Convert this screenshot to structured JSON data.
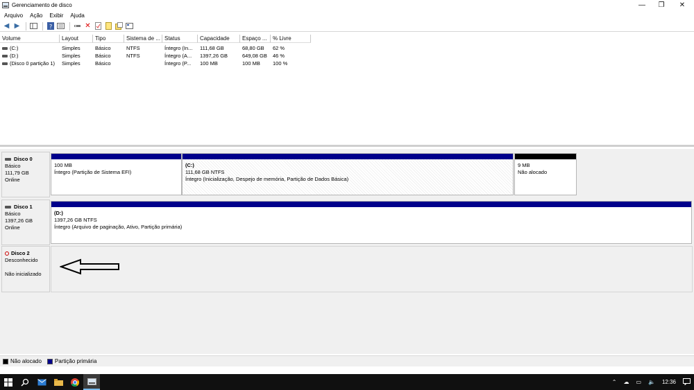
{
  "window": {
    "title": "Gerenciamento de disco",
    "controls": [
      "—",
      "❐",
      "✕"
    ]
  },
  "menu": [
    "Arquivo",
    "Ação",
    "Exibir",
    "Ajuda"
  ],
  "toolbar_icons": [
    "back-icon",
    "forward-icon",
    "console-tree-icon",
    "properties-icon",
    "help-icon",
    "list-view-icon",
    "connect-icon",
    "delete-icon",
    "check-icon",
    "new-volume-icon",
    "format-icon",
    "more-icon"
  ],
  "volume_list": {
    "columns": [
      "Volume",
      "Layout",
      "Tipo",
      "Sistema de ...",
      "Status",
      "Capacidade",
      "Espaço ...",
      "% Livre"
    ],
    "rows": [
      [
        "(C:)",
        "Simples",
        "Básico",
        "NTFS",
        "Íntegro (In...",
        "111,68 GB",
        "68,80 GB",
        "62 %"
      ],
      [
        "(D:)",
        "Simples",
        "Básico",
        "NTFS",
        "Íntegro (A...",
        "1397,26 GB",
        "649,08 GB",
        "46 %"
      ],
      [
        "(Disco 0 partição 1)",
        "Simples",
        "Básico",
        "",
        "Íntegro (P...",
        "100 MB",
        "100 MB",
        "100 %"
      ]
    ]
  },
  "disks": [
    {
      "name": "Disco 0",
      "type": "Básico",
      "size": "111,79 GB",
      "status": "Online",
      "partitions": [
        {
          "title": "",
          "line1": "100 MB",
          "line2": "Íntegro (Partição de Sistema EFI)",
          "kind": "primary"
        },
        {
          "title": "(C:)",
          "line1": "111,68 GB NTFS",
          "line2": "Íntegro (Inicialização, Despejo de memória, Partição de Dados Básica)",
          "kind": "primary"
        },
        {
          "title": "",
          "line1": "9 MB",
          "line2": "Não alocado",
          "kind": "unalloc"
        }
      ]
    },
    {
      "name": "Disco 1",
      "type": "Básico",
      "size": "1397,26 GB",
      "status": "Online",
      "partitions": [
        {
          "title": "(D:)",
          "line1": "1397,26 GB NTFS",
          "line2": "Íntegro (Arquivo de paginação, Ativo, Partição primária)",
          "kind": "primary"
        }
      ]
    },
    {
      "name": "Disco 2",
      "type": "Desconhecido",
      "size": "",
      "status": "Não inicializado"
    }
  ],
  "legend": [
    {
      "label": "Não alocado",
      "color": "#000000"
    },
    {
      "label": "Partição primária",
      "color": "#00008b"
    }
  ],
  "taskbar": {
    "clock": "12:36"
  }
}
